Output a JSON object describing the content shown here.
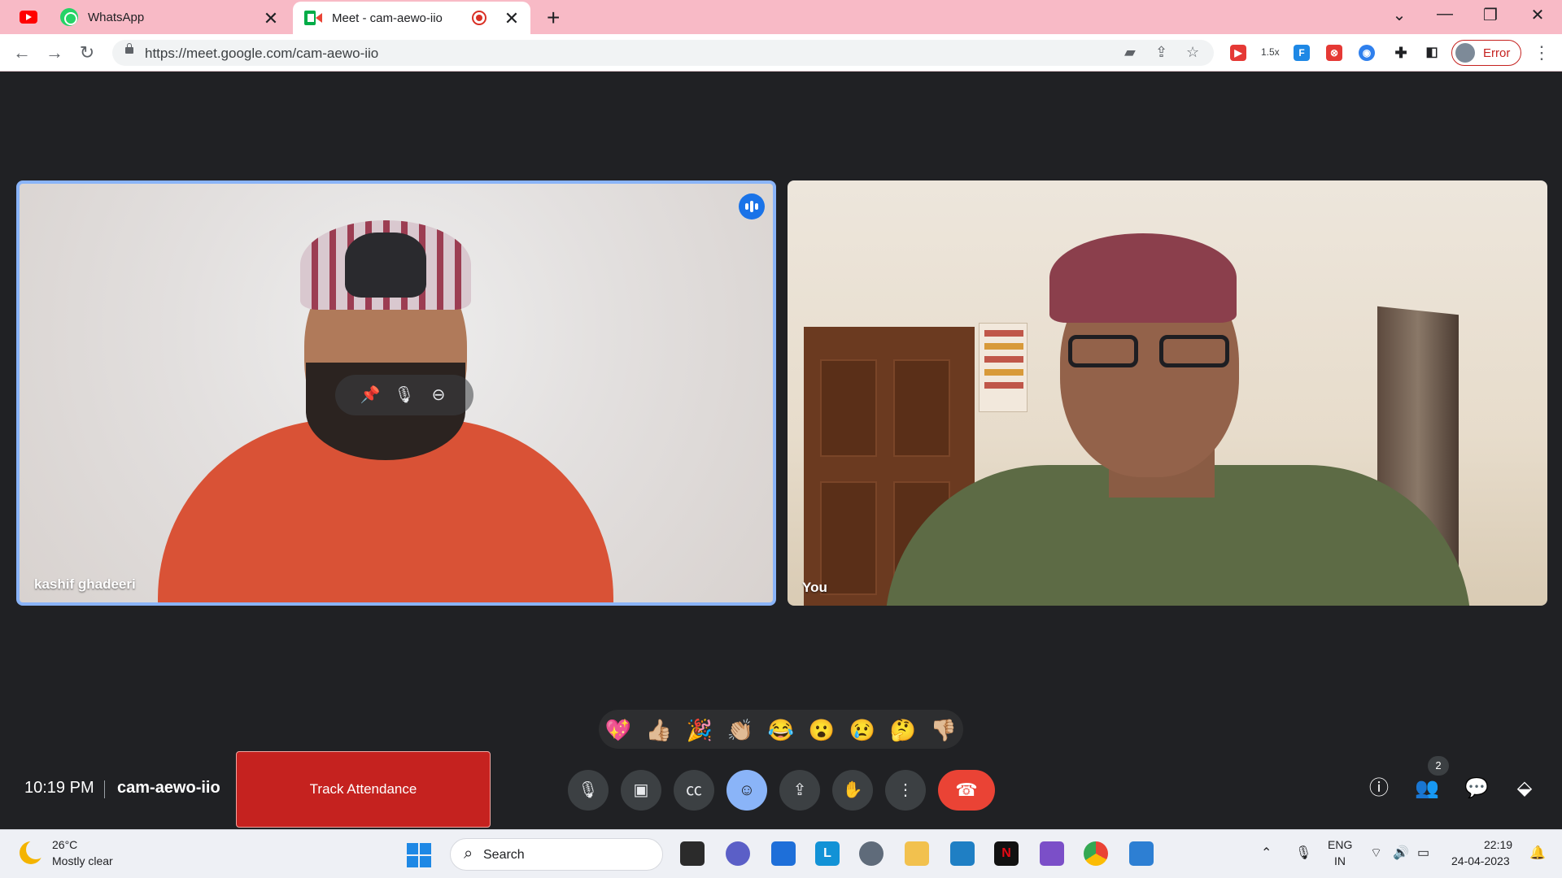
{
  "browser": {
    "tabs": [
      {
        "title": "",
        "icon": "youtube-icon"
      },
      {
        "title": "WhatsApp",
        "icon": "whatsapp-icon"
      },
      {
        "title": "Meet - cam-aewo-iio",
        "icon": "google-meet-icon",
        "active": true,
        "recording": true
      }
    ],
    "url": "https://meet.google.com/cam-aewo-iio",
    "playback_speed": "1.5x",
    "profile_label": "Error"
  },
  "meet": {
    "participants": [
      {
        "name": "kashif ghadeeri",
        "speaking": true
      },
      {
        "name": "You"
      }
    ],
    "reactions": [
      "💖",
      "👍🏼",
      "🎉",
      "👏🏼",
      "😂",
      "😮",
      "😢",
      "🤔",
      "👎🏼"
    ],
    "time": "10:19 PM",
    "meeting_code": "cam-aewo-iio",
    "track_attendance_label": "Track Attendance",
    "people_count": "2"
  },
  "taskbar": {
    "weather_temp": "26°C",
    "weather_desc": "Mostly clear",
    "search_placeholder": "Search",
    "lang_top": "ENG",
    "lang_bottom": "IN",
    "clock_time": "22:19",
    "clock_date": "24-04-2023"
  },
  "colors": {
    "tabstrip": "#f8bac6",
    "stage_bg": "#202124",
    "active_tile_border": "#8ab4f8",
    "end_call": "#ea4335",
    "track_attendance": "#c5221f"
  }
}
